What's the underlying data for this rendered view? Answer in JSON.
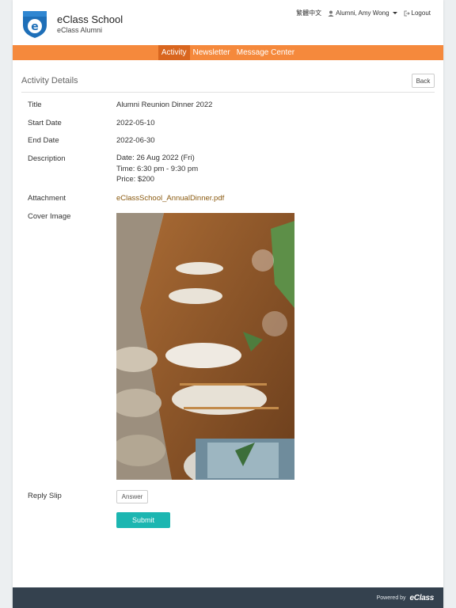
{
  "header": {
    "school_name": "eClass School",
    "school_sub": "eClass Alumni",
    "language_link": "繁體中文",
    "user_name": "Alumni, Amy Wong",
    "logout": "Logout"
  },
  "nav": {
    "tabs": [
      {
        "label": "Activity",
        "active": true
      },
      {
        "label": "Newsletter",
        "active": false
      },
      {
        "label": "Message Center",
        "active": false
      }
    ]
  },
  "section": {
    "title": "Activity Details",
    "back_label": "Back"
  },
  "details": {
    "title_label": "Title",
    "title_value": "Alumni Reunion Dinner 2022",
    "start_label": "Start Date",
    "start_value": "2022-05-10",
    "end_label": "End Date",
    "end_value": "2022-06-30",
    "description_label": "Description",
    "description_lines": [
      "Date: 26 Aug 2022 (Fri)",
      "Time: 6:30 pm - 9:30 pm",
      "Price: $200"
    ],
    "attachment_label": "Attachment",
    "attachment_value": "eClassSchool_AnnualDinner.pdf",
    "cover_label": "Cover Image",
    "reply_label": "Reply Slip",
    "answer_label": "Answer",
    "submit_label": "Submit"
  },
  "footer": {
    "powered_by": "Powered by",
    "brand": "eClass"
  },
  "colors": {
    "nav_bg": "#f5893c",
    "nav_active": "#d9661f",
    "submit": "#1cb6b1",
    "footer_bg": "#34414e",
    "link": "#8a5a10"
  }
}
